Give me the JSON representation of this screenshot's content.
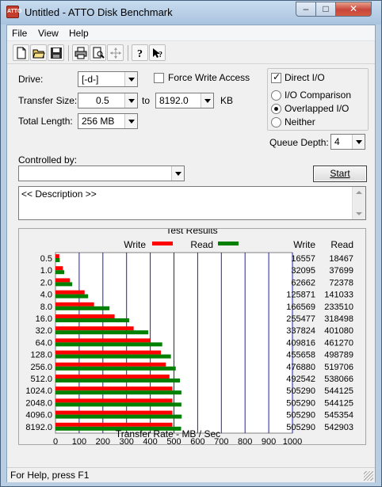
{
  "window": {
    "title": "Untitled - ATTO Disk Benchmark",
    "app_icon_text": "ATTO"
  },
  "menu": [
    "File",
    "View",
    "Help"
  ],
  "toolbar": [
    "new-file-icon",
    "open-folder-icon",
    "save-icon",
    "print-icon",
    "print-preview-icon",
    "move-icon",
    "help-icon",
    "context-help-icon"
  ],
  "form": {
    "drive_label": "Drive:",
    "drive_value": "[-d-]",
    "force_write_label": "Force Write Access",
    "force_write_checked": false,
    "direct_io_label": "Direct I/O",
    "direct_io_checked": true,
    "transfer_size_label": "Transfer Size:",
    "transfer_from": "0.5",
    "to_label": "to",
    "transfer_to": "8192.0",
    "kb_label": "KB",
    "total_length_label": "Total Length:",
    "total_length_value": "256 MB",
    "io_options": [
      "I/O Comparison",
      "Overlapped I/O",
      "Neither"
    ],
    "io_selected": "Overlapped I/O",
    "queue_depth_label": "Queue Depth:",
    "queue_depth_value": "4",
    "controlled_by_label": "Controlled by:",
    "controlled_by_value": "",
    "start_label": "Start",
    "description": "<< Description >>"
  },
  "results": {
    "title": "Test Results",
    "write_legend": "Write",
    "read_legend": "Read",
    "write_col": "Write",
    "read_col": "Read",
    "write_color": "#ff0000",
    "read_color": "#008000",
    "grid_color": "#2020b0"
  },
  "chart_data": {
    "type": "bar",
    "orientation": "horizontal",
    "title": "Test Results",
    "xlabel": "Transfer Rate - MB / Sec",
    "xlim": [
      0,
      1000
    ],
    "xticks": [
      "0",
      "100",
      "200",
      "300",
      "400",
      "500",
      "600",
      "700",
      "800",
      "900",
      "1000"
    ],
    "categories": [
      "0.5",
      "1.0",
      "2.0",
      "4.0",
      "8.0",
      "16.0",
      "32.0",
      "64.0",
      "128.0",
      "256.0",
      "512.0",
      "1024.0",
      "2048.0",
      "4096.0",
      "8192.0"
    ],
    "series": [
      {
        "name": "Write",
        "color": "#ff0000",
        "values": [
          16557,
          32095,
          62662,
          125871,
          166569,
          255477,
          337824,
          409816,
          455658,
          476880,
          492542,
          505290,
          505290,
          505290,
          505290
        ]
      },
      {
        "name": "Read",
        "color": "#008000",
        "values": [
          18467,
          37699,
          72378,
          141033,
          233510,
          318498,
          401080,
          461270,
          498789,
          519706,
          538066,
          544125,
          544125,
          545354,
          542903
        ]
      }
    ],
    "units": "KB/s"
  },
  "status": {
    "text": "For Help, press F1"
  }
}
